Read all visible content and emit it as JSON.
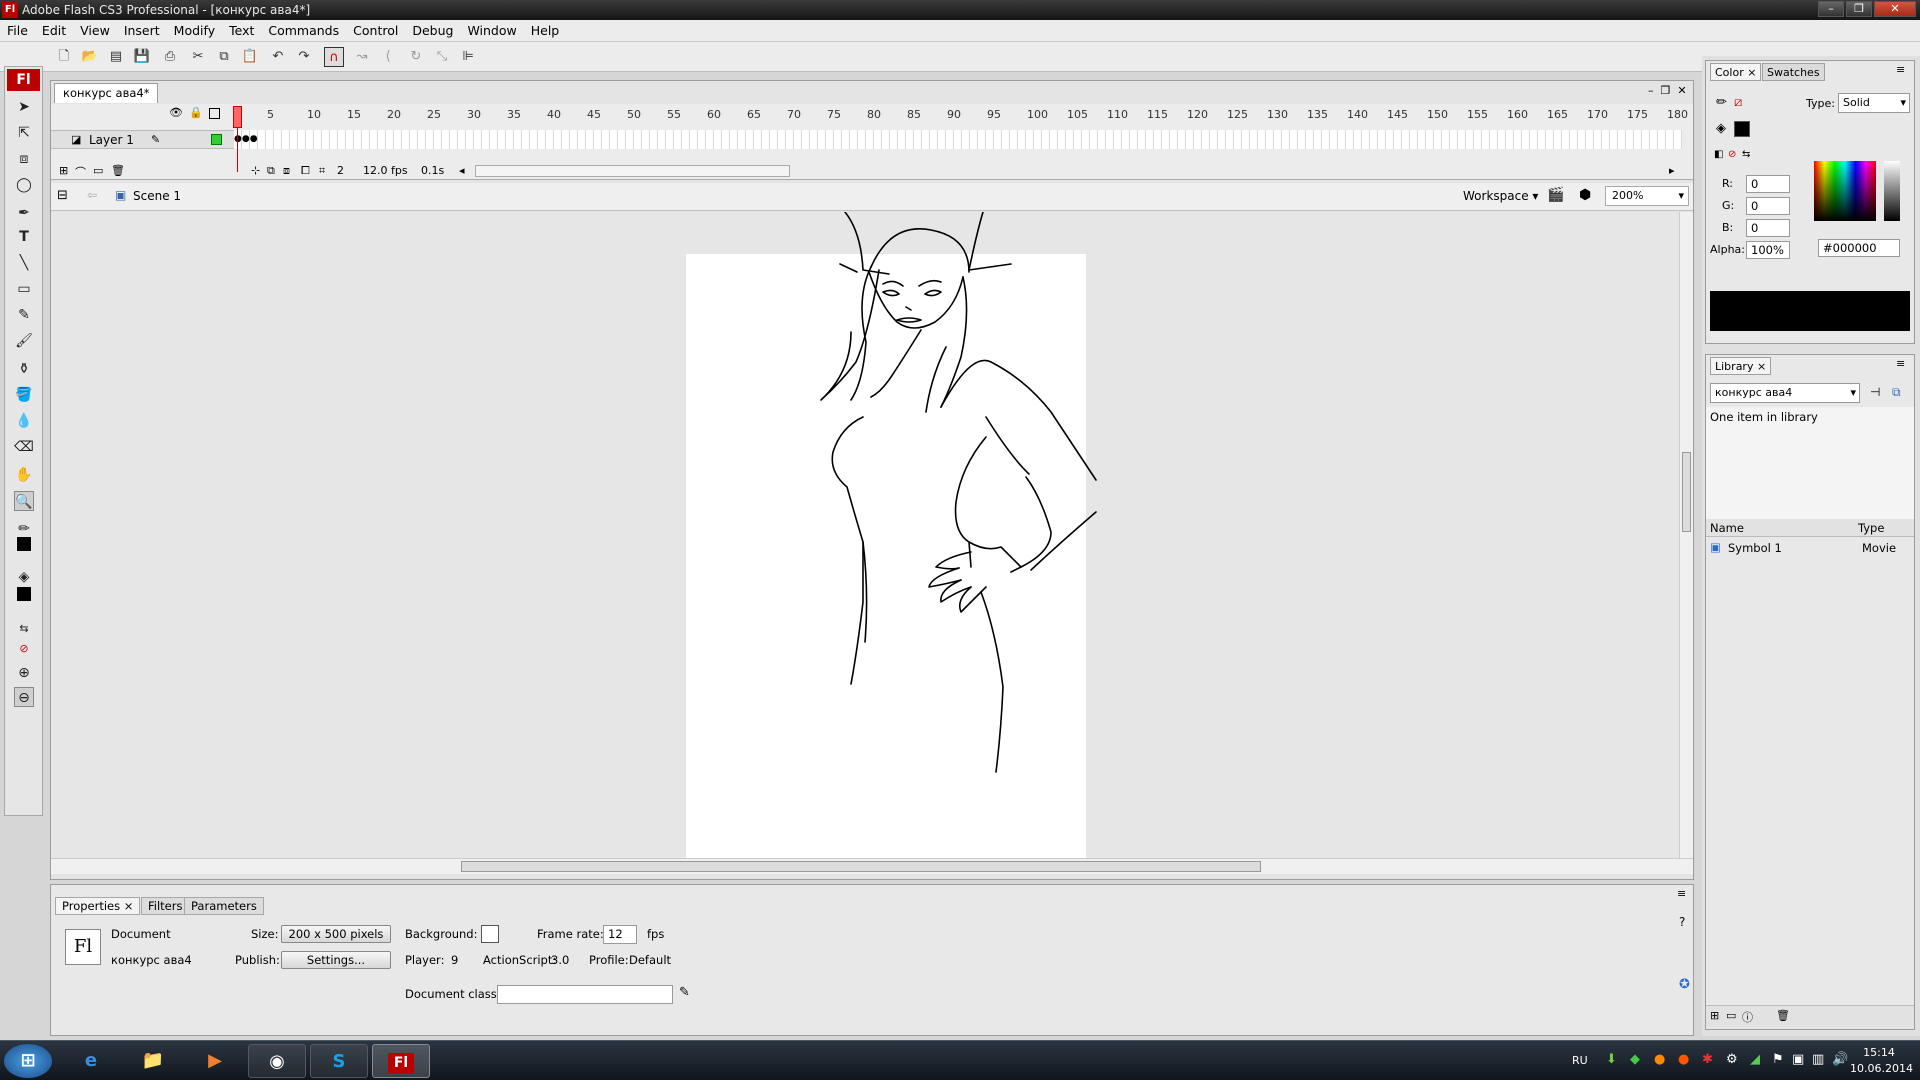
{
  "window": {
    "title": "Adobe Flash CS3 Professional - [конкурс ава4*]",
    "icon_text": "Fl"
  },
  "menu": [
    "File",
    "Edit",
    "View",
    "Insert",
    "Modify",
    "Text",
    "Commands",
    "Control",
    "Debug",
    "Window",
    "Help"
  ],
  "document": {
    "tab_label": "конкурс ава4*",
    "scene": "Scene 1",
    "workspace_label": "Workspace ▾",
    "zoom": "200%"
  },
  "timeline": {
    "ruler": [
      "1",
      "5",
      "10",
      "15",
      "20",
      "25",
      "30",
      "35",
      "40",
      "45",
      "50",
      "55",
      "60",
      "65",
      "70",
      "75",
      "80",
      "85",
      "90",
      "95",
      "100",
      "105",
      "110",
      "115",
      "120",
      "125",
      "130",
      "135",
      "140",
      "145",
      "150",
      "155",
      "160",
      "165",
      "170",
      "175",
      "180"
    ],
    "layer_name": "Layer 1",
    "current_frame": "2",
    "fps": "12.0 fps",
    "elapsed": "0.1s"
  },
  "properties": {
    "tabs": [
      "Properties",
      "Filters",
      "Parameters"
    ],
    "doc_type": "Document",
    "doc_name": "конкурс ава4",
    "size_label": "Size:",
    "size_value": "200 x 500 pixels",
    "publish_label": "Publish:",
    "settings_label": "Settings...",
    "background_label": "Background:",
    "framerate_label": "Frame rate:",
    "framerate_value": "12",
    "fps_unit": "fps",
    "player_label": "Player:",
    "player_value": "9",
    "as_label": "ActionScript:",
    "as_value": "3.0",
    "profile_label": "Profile:",
    "profile_value": "Default",
    "docclass_label": "Document class:",
    "docclass_value": "",
    "fl_icon": "Fl"
  },
  "color_panel": {
    "tabs": [
      "Color",
      "Swatches"
    ],
    "type_label": "Type:",
    "type_value": "Solid",
    "r_label": "R:",
    "r_value": "0",
    "g_label": "G:",
    "g_value": "0",
    "b_label": "B:",
    "b_value": "0",
    "alpha_label": "Alpha:",
    "alpha_value": "100%",
    "hex_value": "#000000",
    "swatch_color": "#000000"
  },
  "library": {
    "tab": "Library",
    "doc_select": "конкурс ава4",
    "count_text": "One item in library",
    "col_name": "Name",
    "col_type": "Type",
    "items": [
      {
        "name": "Symbol 1",
        "type": "Movie"
      }
    ]
  },
  "taskbar": {
    "lang": "RU",
    "time": "15:14",
    "date": "10.06.2014"
  },
  "colors": {
    "accent_red": "#cc0000",
    "title_bg": "#1e1e1e",
    "panel_bg": "#e8e8e8"
  }
}
